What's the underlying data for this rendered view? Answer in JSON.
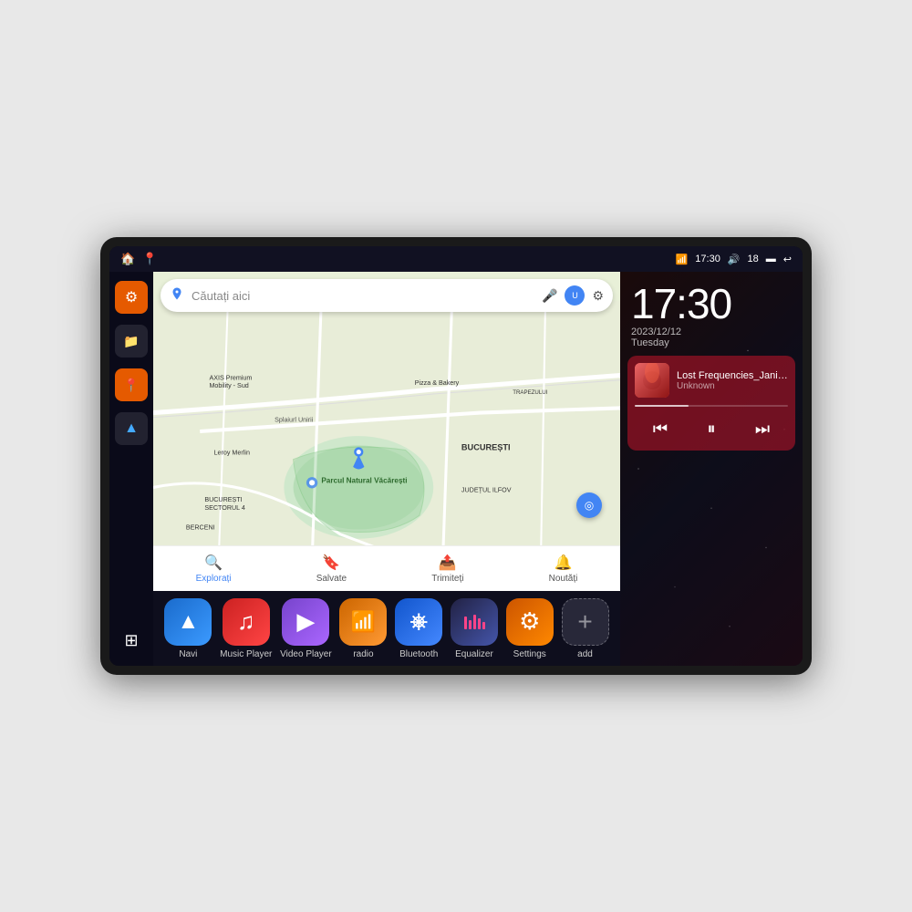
{
  "device": {
    "status_bar": {
      "wifi_icon": "▾",
      "time": "17:30",
      "volume_icon": "🔊",
      "battery_num": "18",
      "battery_icon": "🔋",
      "back_icon": "↩"
    },
    "sidebar": {
      "items": [
        {
          "id": "settings",
          "icon": "⚙",
          "label": "Settings"
        },
        {
          "id": "folder",
          "icon": "📁",
          "label": "File Manager"
        },
        {
          "id": "maps",
          "icon": "📍",
          "label": "Maps"
        },
        {
          "id": "navi",
          "icon": "▲",
          "label": "Navigation"
        }
      ],
      "apps_grid": "⊞"
    },
    "clock": {
      "time": "17:30",
      "date": "2023/12/12",
      "weekday": "Tuesday"
    },
    "music_widget": {
      "song_title": "Lost Frequencies_Janie...",
      "artist": "Unknown",
      "progress": 35,
      "controls": {
        "prev": "⏮",
        "pause": "⏸",
        "next": "⏭"
      }
    },
    "map": {
      "search_placeholder": "Căutați aici",
      "locations": [
        "AXIS Premium Mobility - Sud",
        "Pizza & Bakery",
        "TRAPEZULUI",
        "Parcul Natural Văcărești",
        "BUCUREȘTI",
        "BUCUREȘTI SECTORUL 4",
        "JUDEȚUL ILFOV",
        "BERCENI",
        "Splaiul Unirii",
        "Leroy Merlin"
      ],
      "bottom_nav": [
        {
          "label": "Explorați",
          "icon": "🔍",
          "active": true
        },
        {
          "label": "Salvate",
          "icon": "🔖",
          "active": false
        },
        {
          "label": "Trimiteți",
          "icon": "📤",
          "active": false
        },
        {
          "label": "Noutăți",
          "icon": "🔔",
          "active": false
        }
      ]
    },
    "app_bar": {
      "apps": [
        {
          "id": "navi",
          "label": "Navi",
          "icon": "▲",
          "color_class": "bg-blue-nav"
        },
        {
          "id": "music-player",
          "label": "Music Player",
          "icon": "♫",
          "color_class": "bg-red-music"
        },
        {
          "id": "video-player",
          "label": "Video Player",
          "icon": "▶",
          "color_class": "bg-purple-video"
        },
        {
          "id": "radio",
          "label": "radio",
          "icon": "📶",
          "color_class": "bg-orange-radio"
        },
        {
          "id": "bluetooth",
          "label": "Bluetooth",
          "icon": "⚡",
          "color_class": "bg-blue-bt"
        },
        {
          "id": "equalizer",
          "label": "Equalizer",
          "icon": "≋",
          "color_class": "bg-dark-eq"
        },
        {
          "id": "settings",
          "label": "Settings",
          "icon": "⚙",
          "color_class": "bg-orange-settings"
        },
        {
          "id": "add",
          "label": "add",
          "icon": "+",
          "color_class": "bg-gray-add"
        }
      ]
    }
  }
}
